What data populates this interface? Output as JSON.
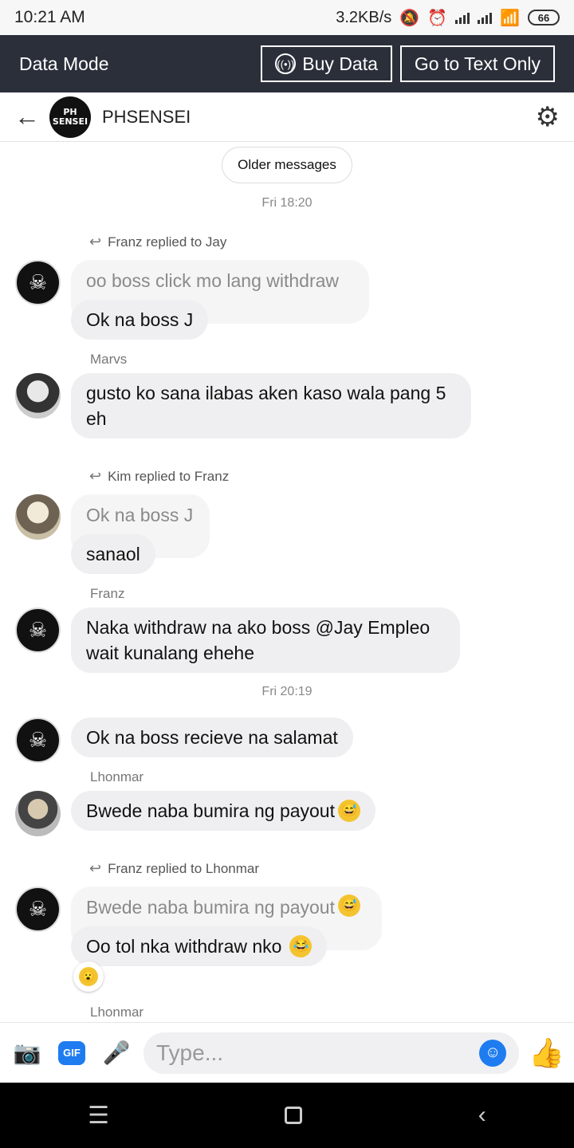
{
  "status": {
    "time": "10:21 AM",
    "speed": "3.2KB/s",
    "battery": "66"
  },
  "data_bar": {
    "title": "Data Mode",
    "buy": "Buy Data",
    "text_only": "Go to Text Only"
  },
  "header": {
    "avatar_text": "PH SENSEI",
    "name": "PHSENSEI"
  },
  "chat": {
    "older": "Older messages",
    "time1": "Fri 18:20",
    "time2": "Fri 20:19",
    "g1": {
      "replied": "Franz replied to Jay",
      "quote": "oo boss click mo lang withdraw",
      "reply": "Ok na boss J"
    },
    "g2": {
      "sender": "Marvs",
      "line1": "gusto ko sana ilabas aken kaso wala pang 5",
      "line2": "eh"
    },
    "g3": {
      "replied": "Kim replied to Franz",
      "quote": "Ok na boss J",
      "reply": "sanaol"
    },
    "g4": {
      "sender": "Franz",
      "line1": "Naka withdraw na ako boss @Jay Empleo",
      "line2": "wait kunalang ehehe"
    },
    "g5": {
      "msg": "Ok na boss recieve na salamat"
    },
    "g6": {
      "sender": "Lhonmar",
      "msg": "Bwede naba bumira ng payout"
    },
    "g7": {
      "replied": "Franz replied to Lhonmar",
      "quote": "Bwede naba bumira ng payout",
      "reply": "Oo tol nka withdraw nko"
    },
    "g8": {
      "sender": "Lhonmar"
    }
  },
  "composer": {
    "placeholder": "Type..."
  },
  "icons": [
    "back-arrow-icon",
    "gear-icon",
    "camera-icon",
    "gif-icon",
    "mic-icon",
    "smile-icon",
    "thumbs-up-icon"
  ],
  "colors": {
    "accent": "#1e7cf0",
    "data_bar": "#2b2f3a",
    "bubble": "#efeff1"
  }
}
